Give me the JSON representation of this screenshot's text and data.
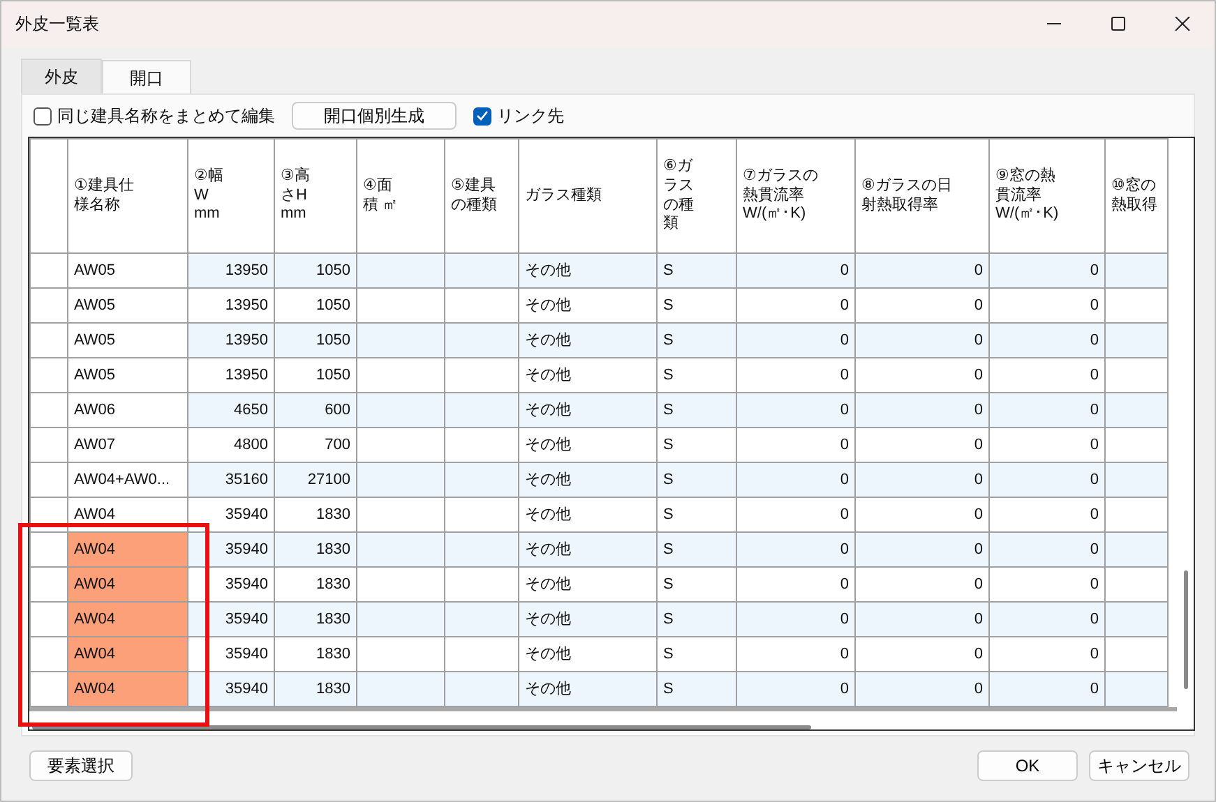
{
  "window": {
    "title": "外皮一覧表"
  },
  "tabs": [
    {
      "label": "外皮",
      "selected": false
    },
    {
      "label": "開口",
      "selected": true
    }
  ],
  "toolbar": {
    "group_edit": {
      "label": "同じ建具名称をまとめて編集",
      "checked": false
    },
    "generate_button": "開口個別生成",
    "link": {
      "label": "リンク先",
      "checked": true
    }
  },
  "table": {
    "columns": [
      "①建具仕様名称",
      "②幅 W mm",
      "③高さH mm",
      "④面積 ㎡",
      "⑤建具の種類",
      "ガラス種類",
      "⑥ガラスの種類",
      "⑦ガラスの熱貫流率 W/(㎡･K)",
      "⑧ガラスの日射熱取得率",
      "⑨窓の熱貫流率 W/(㎡･K)",
      "⑩窓の熱取得"
    ],
    "frame_around_highlighted": true,
    "rows": [
      {
        "cells": [
          "AW05",
          "13950",
          "1050",
          "",
          "",
          "その他",
          "S",
          "0",
          "0",
          "0",
          ""
        ],
        "highlighted": false
      },
      {
        "cells": [
          "AW05",
          "13950",
          "1050",
          "",
          "",
          "その他",
          "S",
          "0",
          "0",
          "0",
          ""
        ],
        "highlighted": false
      },
      {
        "cells": [
          "AW05",
          "13950",
          "1050",
          "",
          "",
          "その他",
          "S",
          "0",
          "0",
          "0",
          ""
        ],
        "highlighted": false
      },
      {
        "cells": [
          "AW05",
          "13950",
          "1050",
          "",
          "",
          "その他",
          "S",
          "0",
          "0",
          "0",
          ""
        ],
        "highlighted": false
      },
      {
        "cells": [
          "AW06",
          "4650",
          "600",
          "",
          "",
          "その他",
          "S",
          "0",
          "0",
          "0",
          ""
        ],
        "highlighted": false
      },
      {
        "cells": [
          "AW07",
          "4800",
          "700",
          "",
          "",
          "その他",
          "S",
          "0",
          "0",
          "0",
          ""
        ],
        "highlighted": false
      },
      {
        "cells": [
          "AW04+AW0...",
          "35160",
          "27100",
          "",
          "",
          "その他",
          "S",
          "0",
          "0",
          "0",
          ""
        ],
        "highlighted": false
      },
      {
        "cells": [
          "AW04",
          "35940",
          "1830",
          "",
          "",
          "その他",
          "S",
          "0",
          "0",
          "0",
          ""
        ],
        "highlighted": false
      },
      {
        "cells": [
          "AW04",
          "35940",
          "1830",
          "",
          "",
          "その他",
          "S",
          "0",
          "0",
          "0",
          ""
        ],
        "highlighted": true
      },
      {
        "cells": [
          "AW04",
          "35940",
          "1830",
          "",
          "",
          "その他",
          "S",
          "0",
          "0",
          "0",
          ""
        ],
        "highlighted": true
      },
      {
        "cells": [
          "AW04",
          "35940",
          "1830",
          "",
          "",
          "その他",
          "S",
          "0",
          "0",
          "0",
          ""
        ],
        "highlighted": true
      },
      {
        "cells": [
          "AW04",
          "35940",
          "1830",
          "",
          "",
          "その他",
          "S",
          "0",
          "0",
          "0",
          ""
        ],
        "highlighted": true
      },
      {
        "cells": [
          "AW04",
          "35940",
          "1830",
          "",
          "",
          "その他",
          "S",
          "0",
          "0",
          "0",
          ""
        ],
        "highlighted": true
      }
    ]
  },
  "footer": {
    "select_button": "要素選択",
    "ok_button": "OK",
    "cancel_button": "キャンセル"
  }
}
